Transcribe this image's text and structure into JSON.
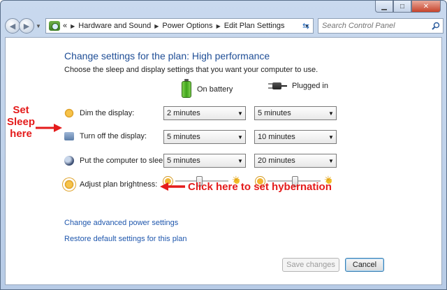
{
  "window": {
    "caption": {
      "minimize": "▁",
      "maximize": "□",
      "close": "✕"
    }
  },
  "nav": {
    "back_icon": "back-arrow-icon",
    "forward_icon": "forward-arrow-icon",
    "overflow": "«",
    "breadcrumbs": [
      "Hardware and Sound",
      "Power Options",
      "Edit Plan Settings"
    ],
    "search_placeholder": "Search Control Panel"
  },
  "content": {
    "heading": "Change settings for the plan: High performance",
    "subtext": "Choose the sleep and display settings that you want your computer to use.",
    "columns": {
      "battery": "On battery",
      "plugged": "Plugged in"
    },
    "rows": [
      {
        "label": "Dim the display:",
        "icon": "sun-icon",
        "battery": "2 minutes",
        "plugged": "5 minutes"
      },
      {
        "label": "Turn off the display:",
        "icon": "monitor-icon",
        "battery": "5 minutes",
        "plugged": "10 minutes"
      },
      {
        "label": "Put the computer to sleep:",
        "icon": "moon-icon",
        "battery": "5 minutes",
        "plugged": "20 minutes"
      }
    ],
    "brightness": {
      "label": "Adjust plan brightness:",
      "battery_level": 0.45,
      "plugged_level": 0.52
    },
    "links": {
      "advanced": "Change advanced power settings",
      "restore": "Restore default settings for this plan"
    },
    "buttons": {
      "save": "Save changes",
      "cancel": "Cancel"
    }
  },
  "annotations": {
    "sleep": [
      "Set",
      "Sleep",
      "here"
    ],
    "hibernate": "Click here to set hybernation",
    "color": "#e41b1b"
  }
}
